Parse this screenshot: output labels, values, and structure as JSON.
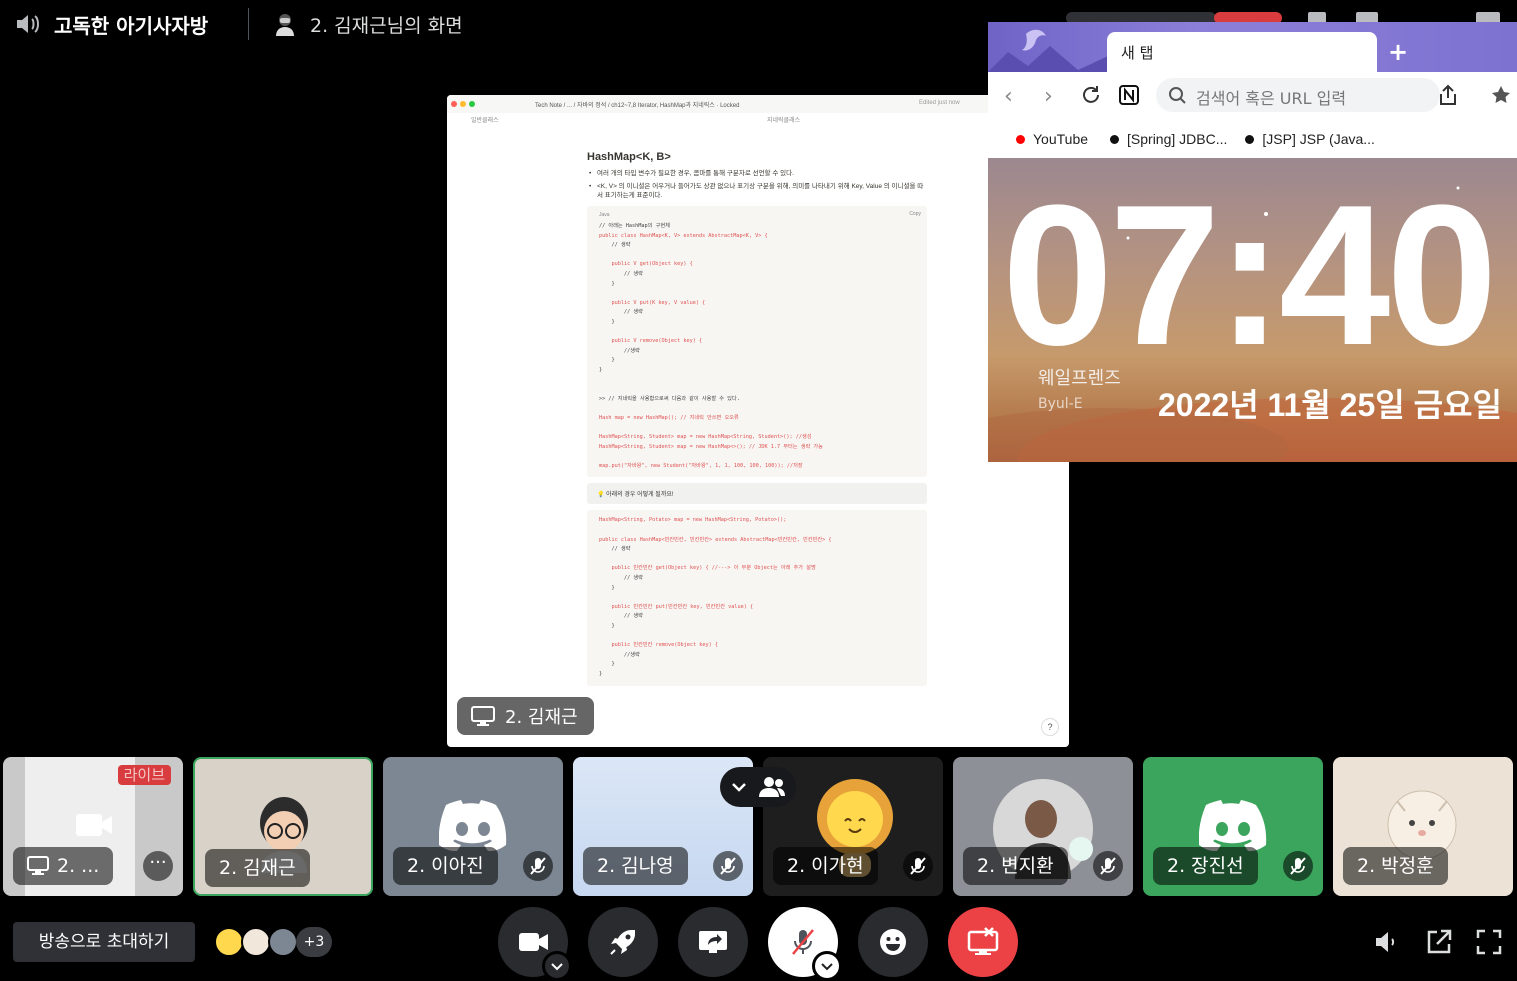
{
  "header": {
    "channel_name": "고독한 아기사자방",
    "screen_title": "2. 김재근님의 화면"
  },
  "stream": {
    "label": "2. 김재근",
    "notion": {
      "breadcrumb": "Tech Note  /  ...  /  자바의 정석  /  ch12~7,8 Iterator, HashMap과 지네릭스   ·   Locked",
      "edited": "Edited just now",
      "sub_left": "일반클래스",
      "sub_right": "지네릭클래스",
      "heading": "HashMap<K, B>",
      "bullets": [
        "여러 개의 타입 변수가 필요한 경우, 콤마를 통해 구분자로 선언할 수 있다.",
        "<K, V> 의 이니셜은 어우거나 들어가도 상관 없으나 표기상 구분을 위해, 의미를 나타내기 위해 Key, Value 의 이니셜을 따서 표기하는게 표준이다."
      ],
      "code_lang": "Java",
      "copy_label": "Copy",
      "code_lines": [
        "// 아래는 HashMap의 구현체",
        "public class HashMap<K, V> extends AbstractMap<K, V> {",
        "    // 생략",
        "",
        "    public V get(Object key) {",
        "        // 생략",
        "    }",
        "",
        "    public V put(K key, V value) {",
        "        // 생략",
        "    }",
        "",
        "    public V remove(Object key) {",
        "        //생략",
        "    }",
        "}",
        "",
        "",
        ">> // 지네릭을 사용함으로써 다음과 같이 사용할 수 있다.",
        "",
        "Hash map = new HashMap(); // 지네릭 안쓰면 오오류",
        "",
        "HashMap<String, Student> map = new HashMap<String, Student>(); //생성",
        "HashMap<String, Student> map = new HashMap<>(); // JDK 1.7 부터는 생략 가능",
        "",
        "map.put(\"자바왕\", new Student(\"자바왕\", 1, 1, 100, 100, 100)); //저장"
      ],
      "callout": "아래의 경우 어떻게 될까요!",
      "code2_lines": [
        "HashMap<String, Potato> map = new HashMap<String, Potato>();",
        "",
        "public class HashMap<빈칸빈칸, 빈칸빈칸> extends AbstractMap<빈칸빈칸, 빈칸빈칸> {",
        "    // 생략",
        "",
        "    public 빈칸빈칸 get(Object key) { //---> 이 부분 Object는 아래 추가 설명",
        "        // 생략",
        "    }",
        "",
        "    public 빈칸빈칸 put(빈칸빈칸 key, 빈칸빈칸 value) {",
        "        // 생략",
        "    }",
        "",
        "    public 빈칸빈칸 remove(Object key) {",
        "        //생략",
        "    }",
        "}"
      ],
      "help": "?"
    }
  },
  "browser": {
    "tab_title": "새 탭",
    "url_placeholder": "검색어 혹은 URL 입력",
    "bookmarks": [
      "YouTube",
      "[Spring] JDBC...",
      "[JSP] JSP (Java..."
    ],
    "clock": "07:40",
    "brand": "웨일프렌즈",
    "artist": "Byul-E",
    "date": "2022년 11월 25일 금요일"
  },
  "participants": [
    {
      "name": "2. ...",
      "badge": "라이브"
    },
    {
      "name": "2. 김재근"
    },
    {
      "name": "2. 이아진"
    },
    {
      "name": "2. 김나영"
    },
    {
      "name": "2. 이가현"
    },
    {
      "name": "2. 변지환"
    },
    {
      "name": "2. 장진선"
    },
    {
      "name": "2. 박정훈"
    }
  ],
  "controls": {
    "invite_label": "방송으로 초대하기",
    "extra_count": "+3"
  },
  "colors": {
    "live_badge": "#d83c3e",
    "leave_button": "#ed4245",
    "selected_border": "#3ba55d",
    "discord_blue": "#5865f2",
    "discord_green_tile": "#3ba55d"
  }
}
